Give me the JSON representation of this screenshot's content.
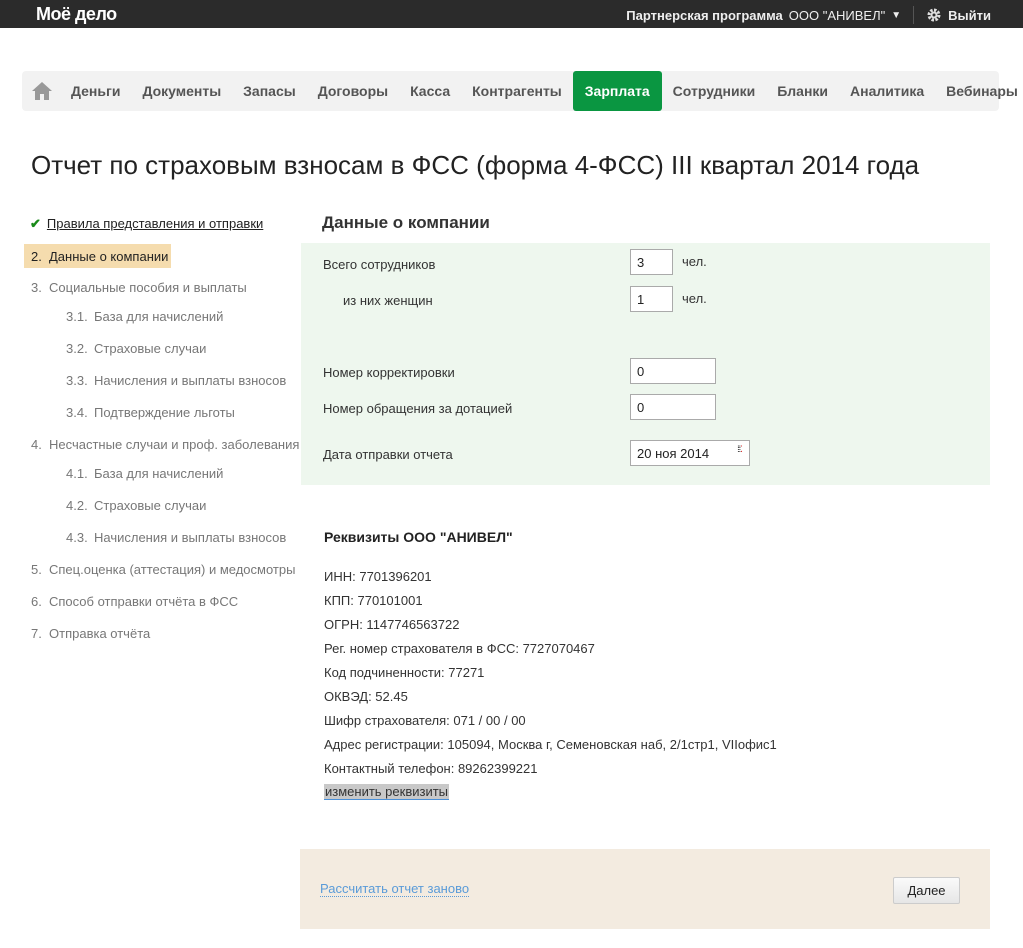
{
  "topbar": {
    "logo": "Моё дело",
    "partner": "Партнерская программа",
    "org": "ООО \"АНИВЕЛ\"",
    "logout": "Выйти"
  },
  "nav": {
    "items": [
      "Деньги",
      "Документы",
      "Запасы",
      "Договоры",
      "Касса",
      "Контрагенты",
      "Зарплата",
      "Сотрудники",
      "Бланки",
      "Аналитика",
      "Вебинары"
    ],
    "active": "Зарплата",
    "accent": "#0a9641"
  },
  "page_title": "Отчет по страховым взносам в ФСС (форма 4-ФСС) III квартал 2014 года",
  "sidebar": [
    {
      "num": "",
      "label": "Правила представления и отправки",
      "state": "done"
    },
    {
      "num": "2.",
      "label": "Данные о компании",
      "state": "active"
    },
    {
      "num": "3.",
      "label": "Социальные пособия и выплаты"
    },
    {
      "num": "3.1.",
      "label": "База для начислений"
    },
    {
      "num": "3.2.",
      "label": "Страховые случаи"
    },
    {
      "num": "3.3.",
      "label": "Начисления и выплаты взносов"
    },
    {
      "num": "3.4.",
      "label": "Подтверждение льготы"
    },
    {
      "num": "4.",
      "label": "Несчастные случаи и проф. заболевания"
    },
    {
      "num": "4.1.",
      "label": "База для начислений"
    },
    {
      "num": "4.2.",
      "label": "Страховые случаи"
    },
    {
      "num": "4.3.",
      "label": "Начисления и выплаты взносов"
    },
    {
      "num": "5.",
      "label": "Спец.оценка (аттестация) и медосмотры"
    },
    {
      "num": "6.",
      "label": "Способ отправки отчёта в ФСС"
    },
    {
      "num": "7.",
      "label": "Отправка отчёта"
    }
  ],
  "section_title": "Данные о компании",
  "form": {
    "employees_label": "Всего сотрудников",
    "employees_value": "3",
    "women_label": "из них женщин",
    "women_value": "1",
    "unit": "чел.",
    "correction_label": "Номер корректировки",
    "correction_value": "0",
    "subsidy_label": "Номер обращения за дотацией",
    "subsidy_value": "0",
    "date_label": "Дата отправки отчета",
    "date_value": "20 ноя 2014"
  },
  "requisites": {
    "title": "Реквизиты ООО \"АНИВЕЛ\"",
    "lines": [
      "ИНН: 7701396201",
      "КПП: 770101001",
      "ОГРН: 1147746563722",
      "Рег. номер страхователя в ФСС: 7727070467",
      "Код подчиненности: 77271",
      "ОКВЭД: 52.45",
      "Шифр страхователя: 071 / 00 / 00",
      "Адрес регистрации: 105094, Москва г, Семеновская наб, 2/1стр1, VIIофис1",
      "Контактный телефон: 89262399221"
    ],
    "edit_link": "изменить реквизиты"
  },
  "footer": {
    "recalc": "Рассчитать отчет заново",
    "next": "Далее"
  }
}
